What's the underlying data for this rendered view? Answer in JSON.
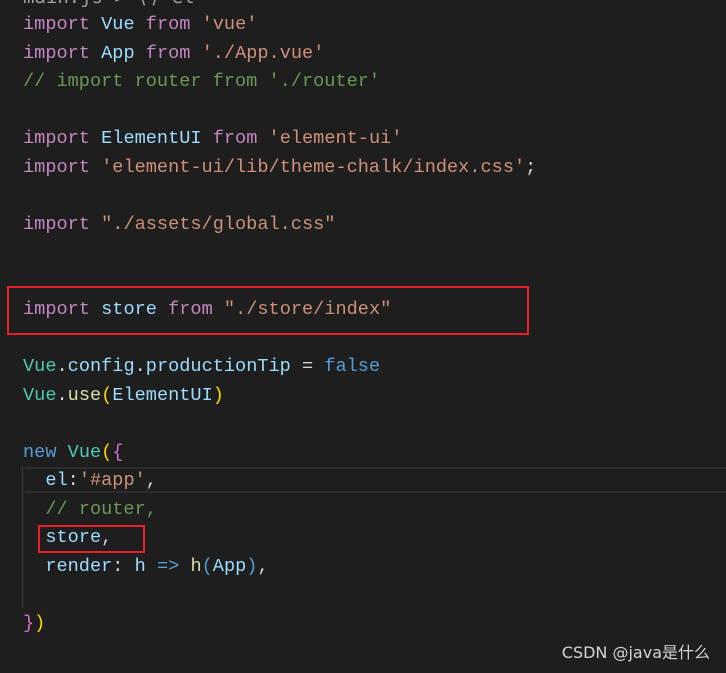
{
  "breadcrumb": "main.js > ⟨⟩ el",
  "colors": {
    "keyword": "#C586C0",
    "variable": "#9CDCFE",
    "string": "#CE9178",
    "comment": "#6A9955",
    "storage": "#569CD6",
    "class": "#4EC9B0",
    "function": "#DCDCAA",
    "bracket1": "#FFD700",
    "bracket2": "#DA70D6",
    "plain": "#D4D4D4",
    "highlight": "#e8202a"
  },
  "lines": [
    [
      [
        "import",
        "keyword"
      ],
      [
        " "
      ],
      [
        "Vue",
        "variable"
      ],
      [
        " "
      ],
      [
        "from",
        "keyword"
      ],
      [
        " "
      ],
      [
        "'vue'",
        "string"
      ]
    ],
    [
      [
        "import",
        "keyword"
      ],
      [
        " "
      ],
      [
        "App",
        "variable"
      ],
      [
        " "
      ],
      [
        "from",
        "keyword"
      ],
      [
        " "
      ],
      [
        "'./App.vue'",
        "string"
      ]
    ],
    [
      [
        "// import router from './router'",
        "comment"
      ]
    ],
    [],
    [
      [
        "import",
        "keyword"
      ],
      [
        " "
      ],
      [
        "ElementUI",
        "variable"
      ],
      [
        " "
      ],
      [
        "from",
        "keyword"
      ],
      [
        " "
      ],
      [
        "'element-ui'",
        "string"
      ]
    ],
    [
      [
        "import",
        "keyword"
      ],
      [
        " "
      ],
      [
        "'element-ui/lib/theme-chalk/index.css'",
        "string"
      ],
      [
        ";",
        "plain"
      ]
    ],
    [],
    [
      [
        "import",
        "keyword"
      ],
      [
        " "
      ],
      [
        "\"./assets/global.css\"",
        "string"
      ]
    ],
    [],
    [],
    [
      [
        "import",
        "keyword"
      ],
      [
        " "
      ],
      [
        "store",
        "variable"
      ],
      [
        " "
      ],
      [
        "from",
        "keyword"
      ],
      [
        " "
      ],
      [
        "\"./store/index\"",
        "string"
      ]
    ],
    [],
    [
      [
        "Vue",
        "class"
      ],
      [
        ".",
        "plain"
      ],
      [
        "config",
        "variable"
      ],
      [
        ".",
        "plain"
      ],
      [
        "productionTip",
        "variable"
      ],
      [
        " = ",
        "plain"
      ],
      [
        "false",
        "storage"
      ]
    ],
    [
      [
        "Vue",
        "class"
      ],
      [
        ".",
        "plain"
      ],
      [
        "use",
        "function"
      ],
      [
        "(",
        "bracket1"
      ],
      [
        "ElementUI",
        "variable"
      ],
      [
        ")",
        "bracket1"
      ]
    ],
    [],
    [
      [
        "new",
        "storage"
      ],
      [
        " "
      ],
      [
        "Vue",
        "class"
      ],
      [
        "(",
        "bracket1"
      ],
      [
        "{",
        "bracket2"
      ]
    ],
    [
      [
        "  el",
        "variable"
      ],
      [
        ":",
        "plain"
      ],
      [
        "'#app'",
        "string"
      ],
      [
        ",",
        "plain"
      ]
    ],
    [
      [
        "  // router,",
        "comment"
      ]
    ],
    [
      [
        "  store",
        "variable"
      ],
      [
        ",",
        "plain"
      ]
    ],
    [
      [
        "  render",
        "variable"
      ],
      [
        ": ",
        "plain"
      ],
      [
        "h",
        "variable"
      ],
      [
        " "
      ],
      [
        "=>",
        "storage"
      ],
      [
        " "
      ],
      [
        "h",
        "function"
      ],
      [
        "(",
        "storage"
      ],
      [
        "App",
        "variable"
      ],
      [
        ")",
        "storage"
      ],
      [
        ",",
        "plain"
      ]
    ],
    [],
    [
      [
        "}",
        "bracket2"
      ],
      [
        ")",
        "bracket1"
      ]
    ]
  ],
  "watermark": "CSDN @java是什么"
}
